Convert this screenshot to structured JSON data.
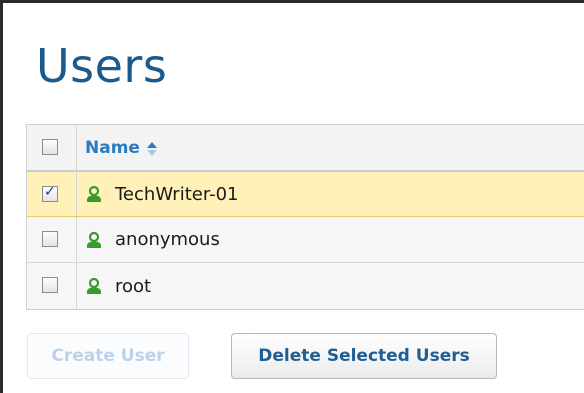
{
  "page": {
    "title": "Users"
  },
  "table": {
    "header": {
      "name_label": "Name",
      "sort_icon": "sort-asc-icon"
    },
    "rows": [
      {
        "name": "TechWriter-01",
        "checked": true,
        "icon": "user-icon"
      },
      {
        "name": "anonymous",
        "checked": false,
        "icon": "user-icon"
      },
      {
        "name": "root",
        "checked": false,
        "icon": "user-icon"
      }
    ]
  },
  "buttons": {
    "create_label": "Create User",
    "delete_label": "Delete Selected Users"
  },
  "colors": {
    "title": "#1d5a8c",
    "header_link": "#2a7bbf",
    "selected_row": "#fff1b8",
    "user_icon": "#3a9a2e",
    "disabled_text": "#b9d4ea"
  }
}
